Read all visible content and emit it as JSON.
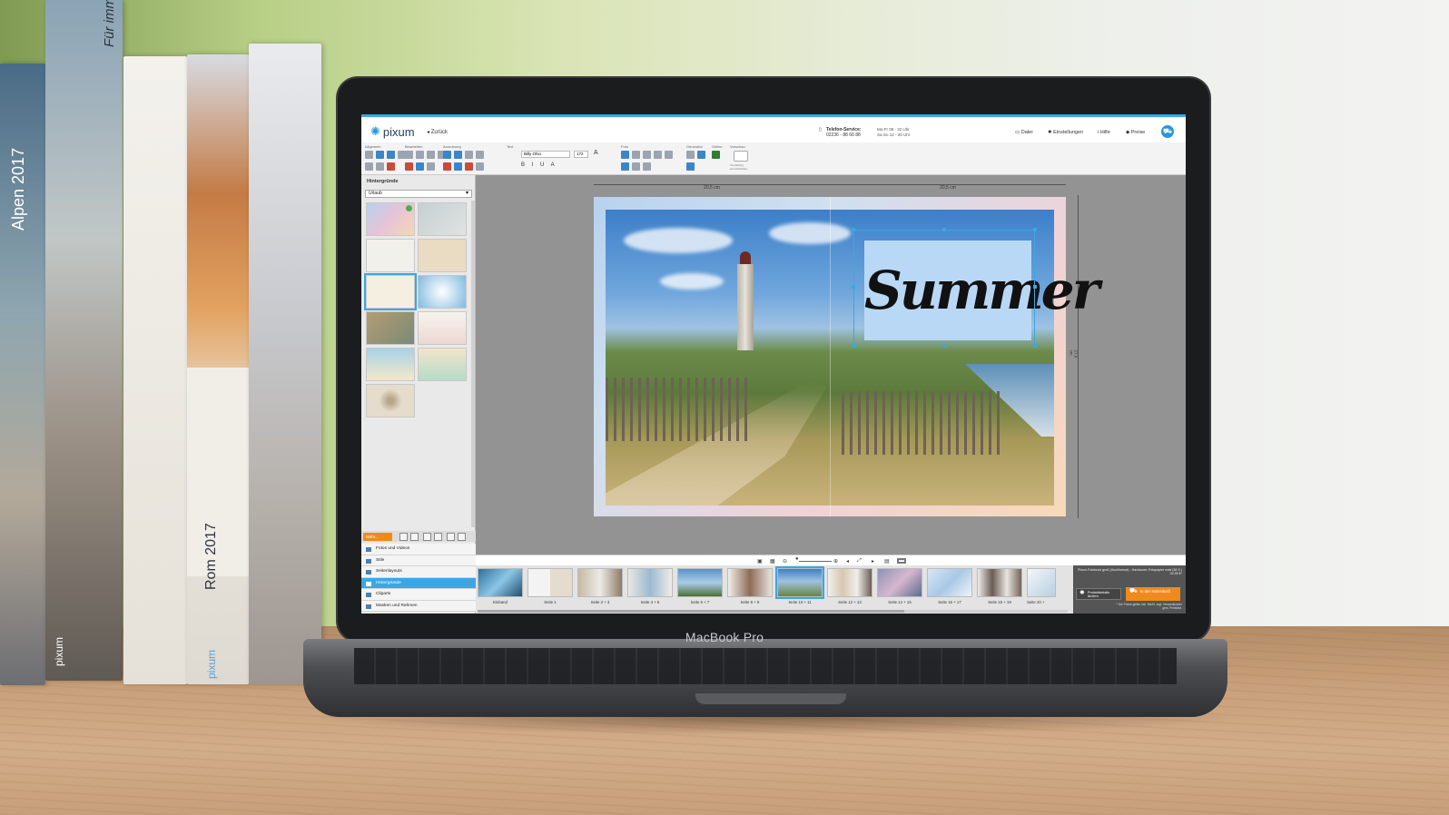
{
  "books": {
    "b1": "Alpen 2017",
    "b1_brand": "pixum",
    "b2": "Für immer",
    "b2_brand": "pixum",
    "b4": "Rom 2017",
    "b4_brand": "pixum"
  },
  "laptop": {
    "brand": "MacBook Pro"
  },
  "app": {
    "logo": "pixum",
    "back_label": "Zurück",
    "service_label": "Telefon-Service:",
    "service_phone": "02236 - 88 66 88",
    "service_hours_1": "Mo-Fr 08 - 22 Uhr",
    "service_hours_2": "Sa-So 12 - 20 Uhr",
    "nav": [
      "Datei",
      "Einstellungen",
      "Hilfe",
      "Preise"
    ]
  },
  "toolbar": {
    "groups": [
      "Allgemein",
      "Bearbeiten",
      "Anordnung",
      "Text",
      "Foto",
      "Generator",
      "Online",
      "Vorschau"
    ],
    "font": "Billy Ohio",
    "size": "172",
    "preview_caption": "Vorstellung anzuschließen"
  },
  "left_panel": {
    "title": "Hintergründe",
    "category": "Urlaub",
    "more_label": "Mehr...",
    "nav_items": [
      "Fotos und Videos",
      "Stile",
      "Seitenlayouts",
      "Hintergründe",
      "Cliparts",
      "Masken und Rahmen"
    ],
    "active_index": 3
  },
  "canvas": {
    "ruler_left": "20,5 cm",
    "ruler_right": "20,5 cm",
    "ruler_vertical": "27,0 cm",
    "text_box": "Summer"
  },
  "pages": [
    {
      "label": "Einband"
    },
    {
      "label": "Seite 1"
    },
    {
      "label": "Seite 2 + 3"
    },
    {
      "label": "Seite 4 + 5"
    },
    {
      "label": "Seite 6 + 7"
    },
    {
      "label": "Seite 8 + 9"
    },
    {
      "label": "Seite 10 + 11",
      "active": true
    },
    {
      "label": "Seite 12 + 13"
    },
    {
      "label": "Seite 14 + 15"
    },
    {
      "label": "Seite 16 + 17"
    },
    {
      "label": "Seite 18 + 19"
    },
    {
      "label": "Seite 20 +"
    }
  ],
  "info": {
    "product": "Pixum Fotobuch groß (Hochformat) - Hardcover, Fotopapier matt (36 S.)",
    "price": "32,95 €*",
    "product_details_label": "Produktdetails ändern",
    "cart_label": "In den Warenkorb",
    "fine_print_1": "* Die Preise gelten inkl. MwSt. zzgl. Versandkosten",
    "fine_print_2": "gem. Preisliste."
  },
  "colors": {
    "accent": "#3aa7e4",
    "cart": "#f08a1c"
  }
}
